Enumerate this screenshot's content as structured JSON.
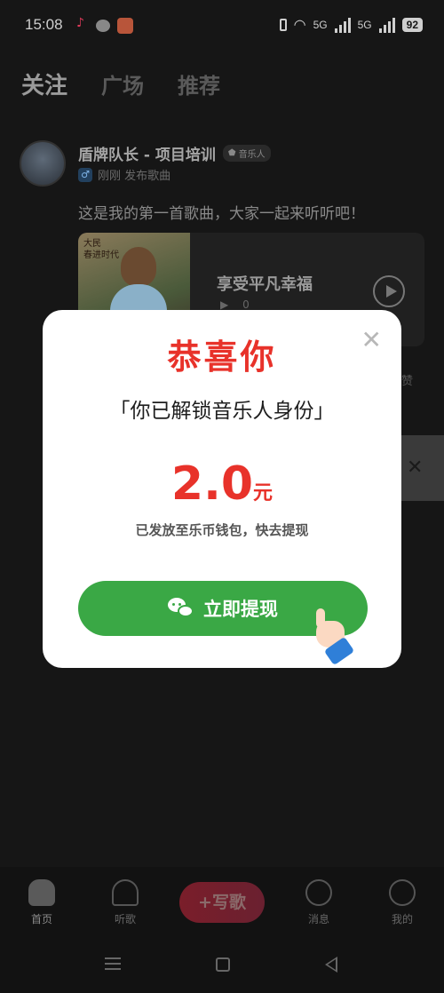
{
  "status": {
    "time": "15:08",
    "network1": "5G",
    "network2": "5G",
    "battery": "92"
  },
  "tabs": [
    {
      "label": "关注"
    },
    {
      "label": "广场"
    },
    {
      "label": "推荐"
    }
  ],
  "post": {
    "author": "盾牌队长 - 项目培训",
    "badge": "音乐人",
    "time": "刚刚 发布歌曲",
    "text": "这是我的第一首歌曲，大家一起来听听吧！",
    "song": {
      "cover_text_1": "大民",
      "cover_text_2": "春进时代",
      "title": "享受平凡幸福",
      "plays": "0"
    },
    "like": "赞"
  },
  "modal": {
    "title": "恭喜你",
    "subtitle": "「你已解锁音乐人身份」",
    "amount": "2.0",
    "unit": "元",
    "desc": "已发放至乐币钱包，快去提现",
    "button": "立即提现",
    "close": "✕"
  },
  "nav": {
    "home": "首页",
    "listen": "听歌",
    "write": "+写歌",
    "messages": "消息",
    "me": "我的"
  },
  "colors": {
    "accent_red": "#e8322a",
    "button_green": "#3aa845"
  }
}
